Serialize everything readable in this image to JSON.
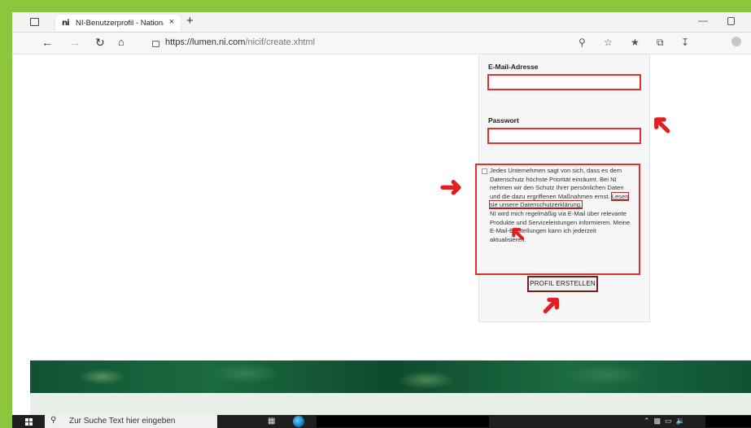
{
  "browser": {
    "tab_title": "NI-Benutzerprofil - National Instruments",
    "tab_logo": "ni",
    "tab_close": "×",
    "new_tab": "+",
    "url_host": "https://lumen.ni.com",
    "url_path": "/nicif/create.xhtml",
    "icons": [
      "window-icon",
      "back-icon",
      "forward-icon",
      "reload-icon",
      "home-icon",
      "lock-icon",
      "zoom-icon",
      "add-favorite-icon",
      "favorites-icon",
      "collections-icon",
      "download-icon",
      "profile-icon"
    ]
  },
  "form": {
    "email_label": "E-Mail-Adresse",
    "email_value": "",
    "password_label": "Passwort",
    "password_value": "",
    "consent_text_1": "Jedes Unternehmen sagt von sich, dass es dem Datenschutz höchste Priorität einräumt. Bei NI nehmen wir den Schutz Ihrer persönlichen Daten und die dazu ergriffenen Maßnahmen ernst.",
    "consent_link": "Lesen sie unsere Datenschutzerklärung.",
    "consent_text_2": "NI wird mich regelmäßig via E-Mail über relevante Produkte und Serviceleistungen informieren. Meine E-Mail-Einstellungen kann ich jederzeit aktualisieren.",
    "consent_checked": false,
    "submit_label": "PROFIL ERSTELLEN"
  },
  "annotations": {
    "arrow_color": "#e02020",
    "highlight_color": "#e03030"
  },
  "taskbar": {
    "search_placeholder": "Zur Suche Text hier eingeben",
    "tray_icons": [
      "chevron-up-icon",
      "network-icon",
      "monitor-icon",
      "volume-icon"
    ]
  }
}
